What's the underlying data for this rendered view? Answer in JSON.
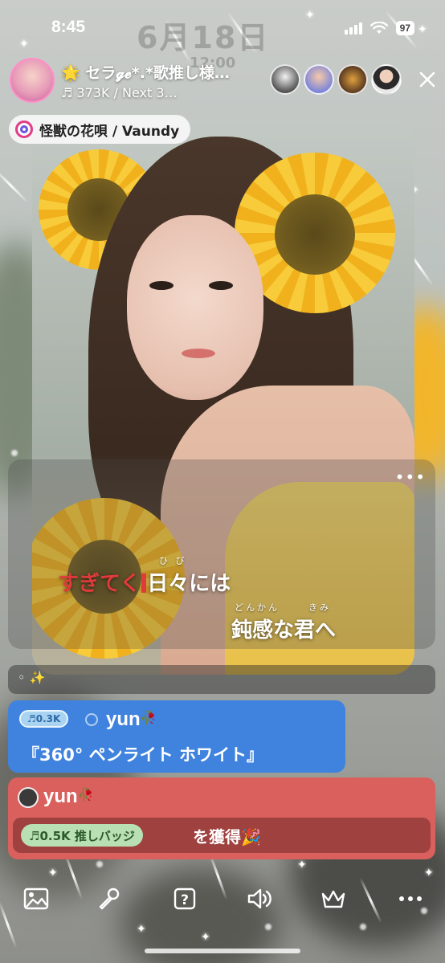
{
  "status_bar": {
    "time": "8:45",
    "battery": "97"
  },
  "lockscreen_ghost": {
    "date": "6月18日",
    "time": "12:00"
  },
  "header": {
    "host_name": "🌟 セラ𝓰𝓮*.*歌推し様…",
    "host_stats": "♬ 373K / Next 3…",
    "viewer_count": 4
  },
  "song": {
    "title": "怪獣の花唄 / Vaundy"
  },
  "lyrics": {
    "line1_sung": "すぎてく",
    "line1_rest": "日々には",
    "line1_ruby": "ひ  び",
    "line2": "鈍感な君へ",
    "line2_ruby_1": "どんかん",
    "line2_ruby_2": "きみ"
  },
  "gift_message": {
    "badge": "♬0.3K",
    "user": "yun",
    "text": "『360° ペンライト ホワイト』"
  },
  "award_message": {
    "user": "yun",
    "badge": "♬0.5K 推しバッジ",
    "text": "を獲得🎉"
  },
  "colors": {
    "gift_bg": "#3f83df",
    "award_bg": "#d9605c",
    "lyric_highlight": "#e03a3a"
  },
  "icons": [
    "image-icon",
    "microphone-icon",
    "question-box-icon",
    "speaker-icon",
    "crown-icon",
    "more-icon"
  ]
}
